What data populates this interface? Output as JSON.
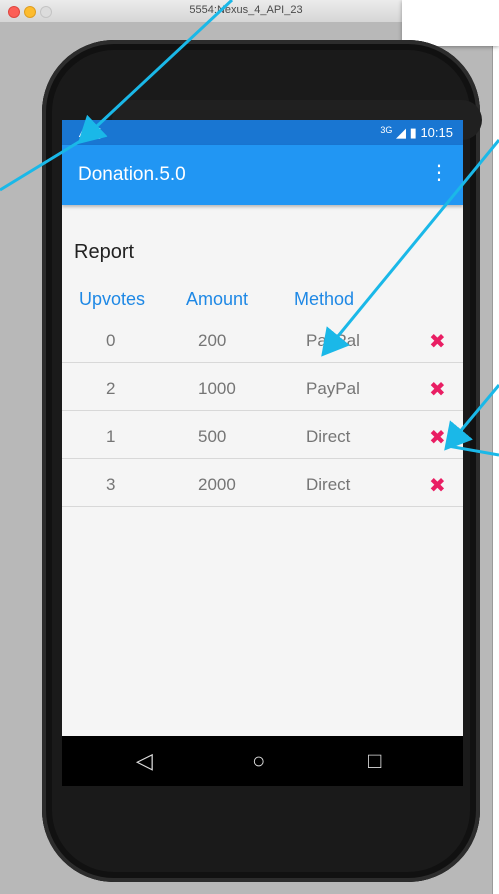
{
  "window": {
    "title": "5554:Nexus_4_API_23"
  },
  "statusbar": {
    "network": "3G",
    "time": "10:15"
  },
  "app": {
    "title": "Donation.5.0",
    "menu_icon": "⋮"
  },
  "report": {
    "heading": "Report",
    "columns": [
      "Upvotes",
      "Amount",
      "Method"
    ],
    "rows": [
      {
        "upvotes": "0",
        "amount": "200",
        "method": "PayPal"
      },
      {
        "upvotes": "2",
        "amount": "1000",
        "method": "PayPal"
      },
      {
        "upvotes": "1",
        "amount": "500",
        "method": "Direct"
      },
      {
        "upvotes": "3",
        "amount": "2000",
        "method": "Direct"
      }
    ]
  },
  "icons": {
    "delete": "✖",
    "back": "◁",
    "home": "○",
    "recent": "□"
  },
  "colors": {
    "appbar": "#2196f3",
    "statusbar": "#1976d2",
    "column_header": "#1e88e5",
    "delete": "#e91e63",
    "arrow": "#1ab8e8"
  }
}
